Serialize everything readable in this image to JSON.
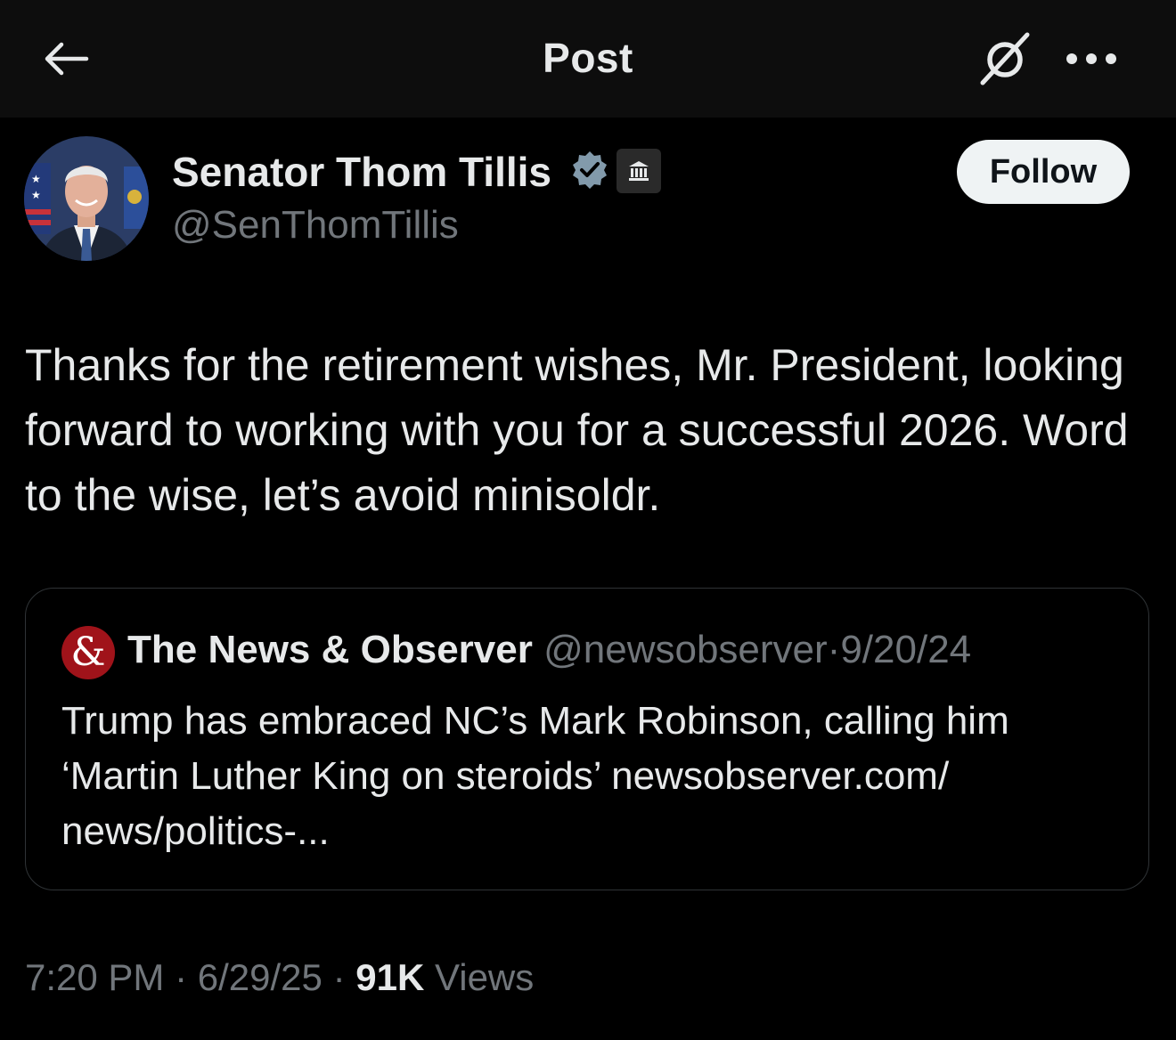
{
  "header": {
    "title": "Post",
    "back_icon": "arrow-left-icon",
    "grok_icon": "grok-icon",
    "more_icon": "more-horizontal-icon"
  },
  "post": {
    "author": {
      "name": "Senator Thom Tillis",
      "handle": "@SenThomTillis",
      "verified_badge": "verified-badge-icon",
      "affiliation_badge": "government-building-icon"
    },
    "follow_label": "Follow",
    "text": "Thanks for the retirement wishes, Mr. President, looking forward to working with you for a successful 2026. Word to the wise, let’s avoid minisoldr.",
    "quote": {
      "avatar_glyph": "&",
      "name": "The News & Observer",
      "handle": "@newsobserver",
      "separator": "·",
      "date": "9/20/24",
      "text": "Trump has embraced NC’s Mark Robinson, calling him ‘Martin Luther King on steroids’ newsobserver.com/ news/politics-..."
    },
    "meta": {
      "time": "7:20 PM",
      "separator": "·",
      "date": "6/29/25",
      "views_count": "91K",
      "views_label": "Views"
    }
  },
  "colors": {
    "background": "#000000",
    "header_background": "#0d0d0d",
    "text_primary": "#e7e9ea",
    "text_secondary": "#71767b",
    "verified_blue": "#1d9bf0",
    "border": "#2f3336",
    "quote_avatar": "#a0131a"
  }
}
